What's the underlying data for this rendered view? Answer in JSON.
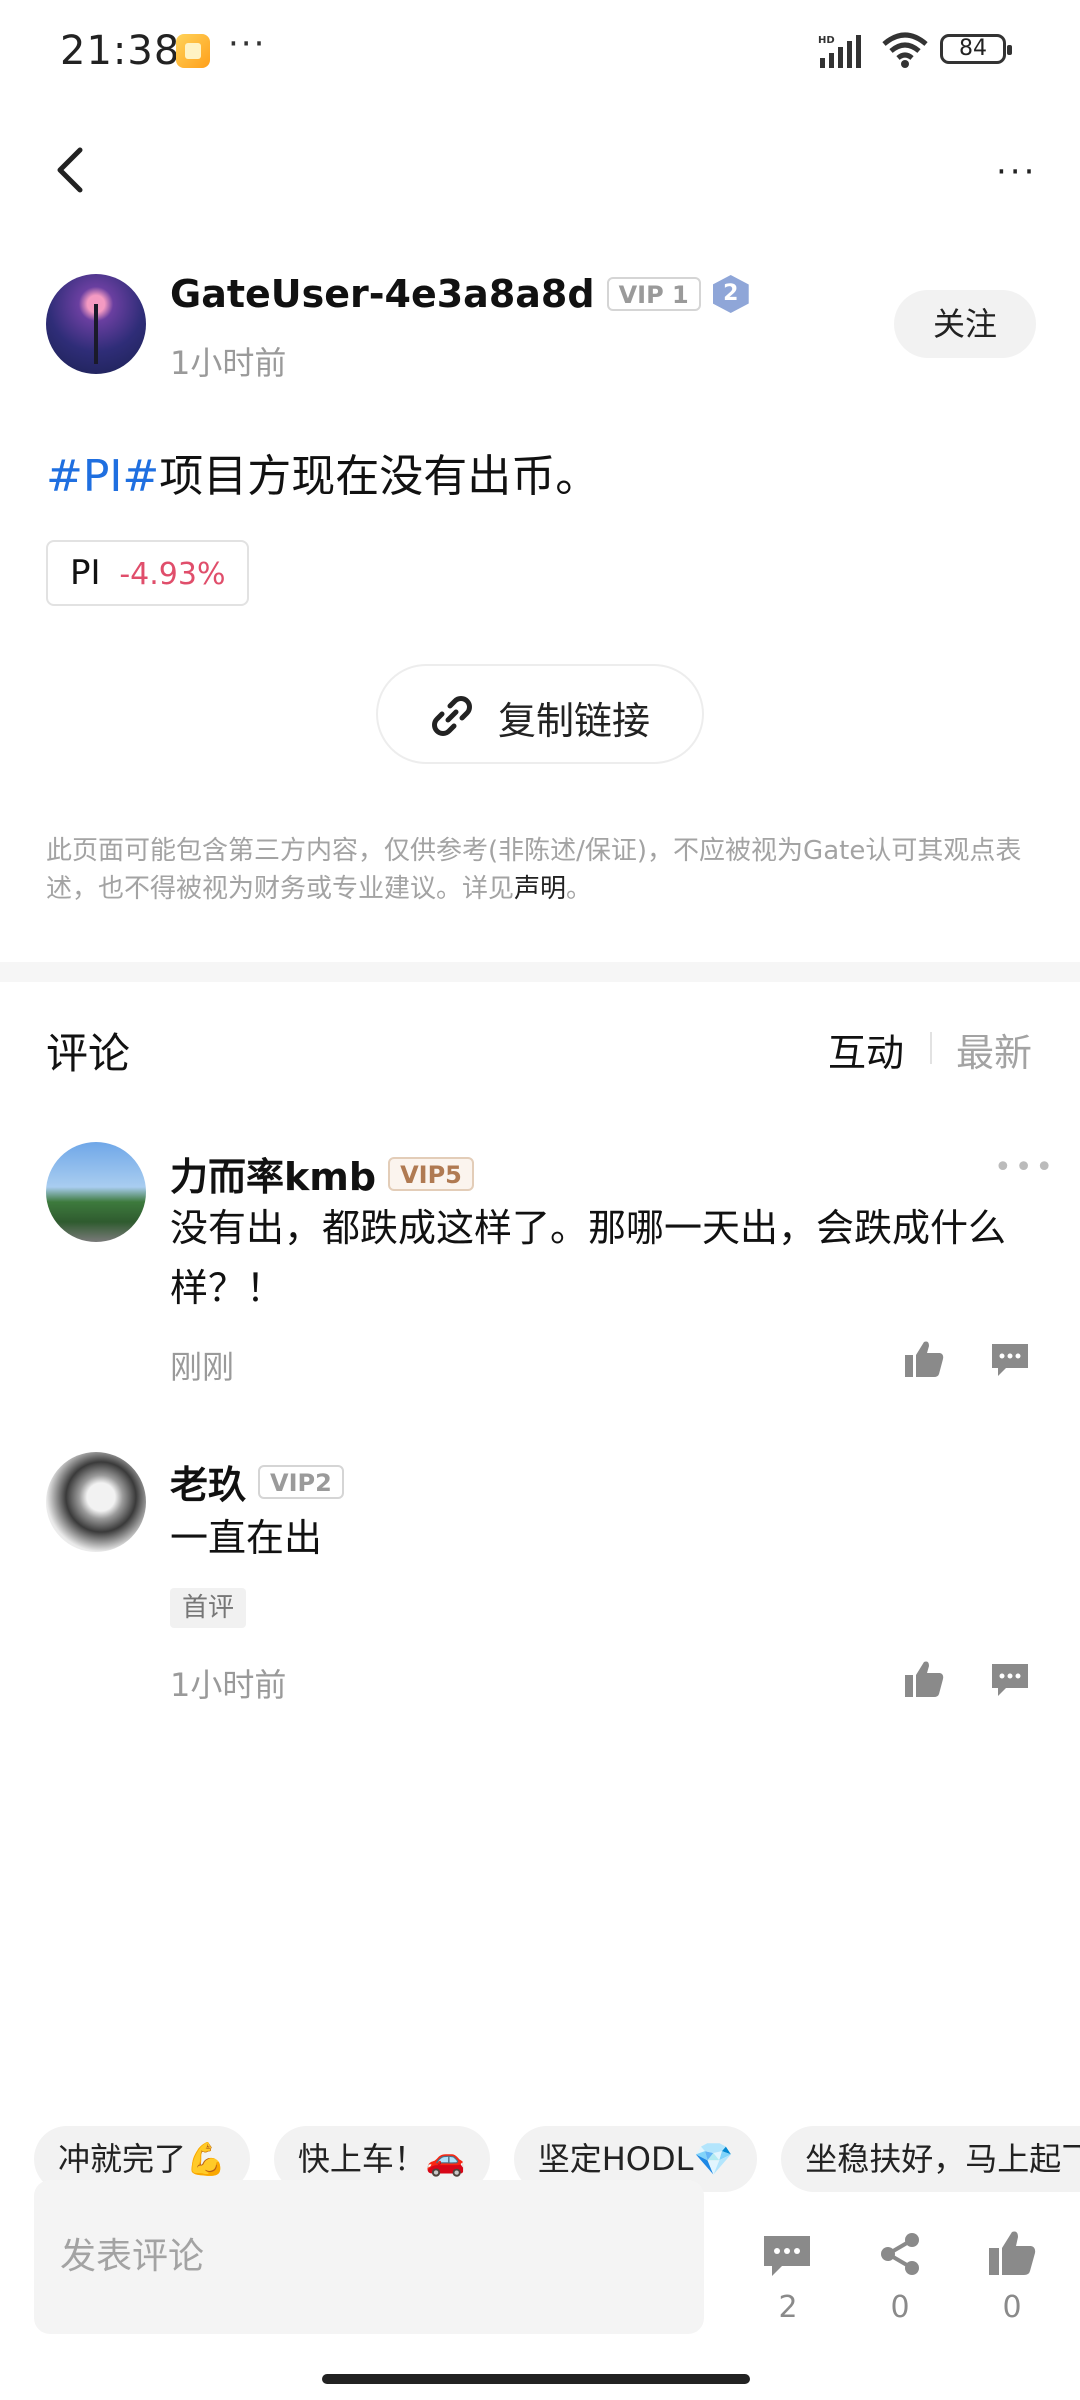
{
  "status_bar": {
    "time": "21:38",
    "dots": "···",
    "battery": "84",
    "hd": "HD"
  },
  "nav": {
    "more": "···"
  },
  "author": {
    "name": "GateUser-4e3a8a8d",
    "vip": "VIP 1",
    "level": "2",
    "time": "1小时前",
    "follow_label": "关注"
  },
  "post": {
    "hashtag": "#PI#",
    "text": "项目方现在没有出币。",
    "token": {
      "symbol": "PI",
      "change": "-4.93%"
    },
    "copy_link_label": "复制链接"
  },
  "disclaimer": {
    "text": "此页面可能包含第三方内容，仅供参考(非陈述/保证)，不应被视为Gate认可其观点表述，也不得被视为财务或专业建议。详见",
    "link_label": "声明",
    "end": "。"
  },
  "comments_section": {
    "title": "评论",
    "sort_hot": "互动",
    "sort_new": "最新",
    "items": [
      {
        "name": "力而率kmb",
        "vip": "VIP5",
        "text": "没有出，都跌成这样了。那哪一天出，会跌成什么样？！",
        "time": "刚刚"
      },
      {
        "name": "老玖",
        "vip": "VIP2",
        "text": "一直在出",
        "tag": "首评",
        "time": "1小时前"
      }
    ]
  },
  "quick_replies": [
    "冲就完了💪",
    "快上车！🚗",
    "坚定HODL💎",
    "坐稳扶好，马上起飞"
  ],
  "bottom_bar": {
    "input_placeholder": "发表评论",
    "comment_count": "2",
    "share_count": "0",
    "like_count": "0"
  },
  "colors": {
    "hashtag": "#1f6fe0",
    "negative": "#e04e6b",
    "muted": "#9a9a9a"
  }
}
